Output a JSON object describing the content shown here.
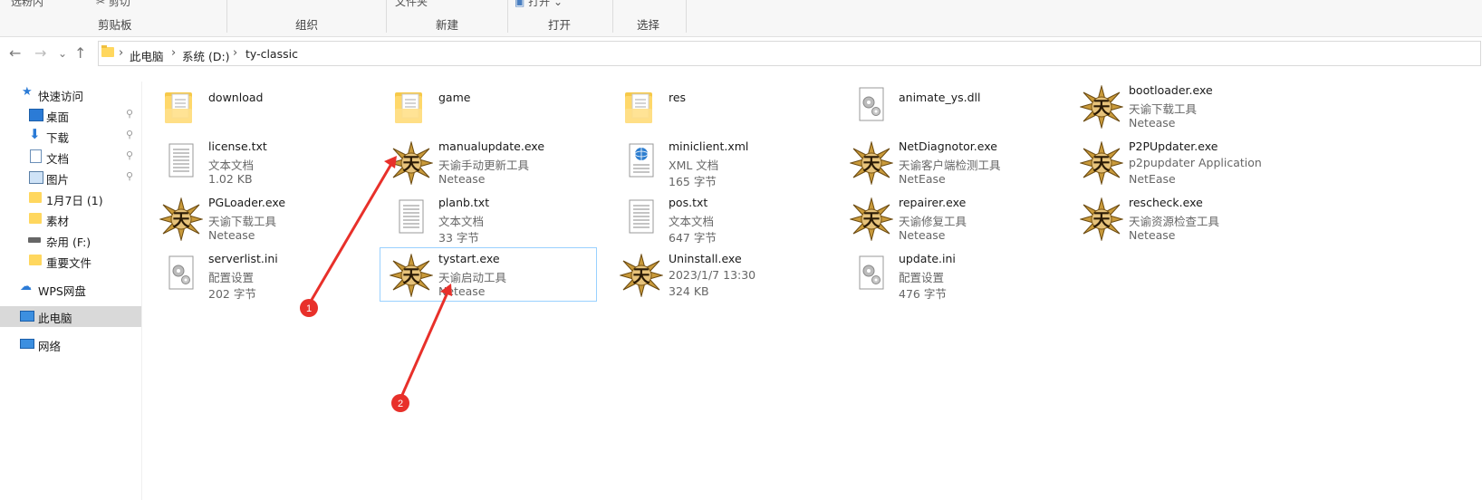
{
  "ribbon": {
    "fragments": [
      "选粉内",
      "剪切",
      "文件夹",
      "打开"
    ],
    "groups": [
      "剪贴板",
      "组织",
      "新建",
      "打开",
      "选择"
    ]
  },
  "nav": {
    "back": "←",
    "forward": "→",
    "dropdown": "⌄",
    "up": "↑",
    "breadcrumb": [
      "此电脑",
      "系统 (D:)",
      "ty-classic"
    ]
  },
  "sidebar": {
    "items": [
      {
        "label": "快速访问",
        "icon": "star-icon"
      },
      {
        "label": "桌面",
        "icon": "desktop-icon",
        "pinned": true
      },
      {
        "label": "下载",
        "icon": "download-icon",
        "pinned": true
      },
      {
        "label": "文档",
        "icon": "document-icon",
        "pinned": true
      },
      {
        "label": "图片",
        "icon": "picture-icon",
        "pinned": true
      },
      {
        "label": "1月7日 (1)",
        "icon": "folder-icon"
      },
      {
        "label": "素材",
        "icon": "folder-icon"
      },
      {
        "label": "杂用 (F:)",
        "icon": "drive-icon"
      },
      {
        "label": "重要文件",
        "icon": "folder-icon"
      },
      {
        "label": "WPS网盘",
        "icon": "cloud-icon"
      },
      {
        "label": "此电脑",
        "icon": "computer-icon",
        "selected": true
      },
      {
        "label": "网络",
        "icon": "network-icon"
      }
    ],
    "pin_glyph": "📌"
  },
  "files": [
    {
      "name": "download",
      "line2": "",
      "line3": "",
      "icon": "folder"
    },
    {
      "name": "game",
      "line2": "",
      "line3": "",
      "icon": "folder"
    },
    {
      "name": "res",
      "line2": "",
      "line3": "",
      "icon": "folder"
    },
    {
      "name": "animate_ys.dll",
      "line2": "",
      "line3": "",
      "icon": "dll"
    },
    {
      "name": "bootloader.exe",
      "line2": "天谕下载工具",
      "line3": "Netease",
      "icon": "tianyu"
    },
    {
      "name": "license.txt",
      "line2": "文本文档",
      "line3": "1.02 KB",
      "icon": "txt"
    },
    {
      "name": "manualupdate.exe",
      "line2": "天谕手动更新工具",
      "line3": "Netease",
      "icon": "tianyu"
    },
    {
      "name": "miniclient.xml",
      "line2": "XML 文档",
      "line3": "165 字节",
      "icon": "xml"
    },
    {
      "name": "NetDiagnotor.exe",
      "line2": "天谕客户端检测工具",
      "line3": "NetEase",
      "icon": "tianyu"
    },
    {
      "name": "P2PUpdater.exe",
      "line2": "p2pupdater Application",
      "line3": "NetEase",
      "icon": "tianyu"
    },
    {
      "name": "PGLoader.exe",
      "line2": "天谕下载工具",
      "line3": "Netease",
      "icon": "tianyu"
    },
    {
      "name": "planb.txt",
      "line2": "文本文档",
      "line3": "33 字节",
      "icon": "txt"
    },
    {
      "name": "pos.txt",
      "line2": "文本文档",
      "line3": "647 字节",
      "icon": "txt"
    },
    {
      "name": "repairer.exe",
      "line2": "天谕修复工具",
      "line3": "Netease",
      "icon": "tianyu"
    },
    {
      "name": "rescheck.exe",
      "line2": "天谕资源检查工具",
      "line3": "Netease",
      "icon": "tianyu"
    },
    {
      "name": "serverlist.ini",
      "line2": "配置设置",
      "line3": "202 字节",
      "icon": "ini"
    },
    {
      "name": "tystart.exe",
      "line2": "天谕启动工具",
      "line3": "Netease",
      "icon": "tianyu",
      "selected": true
    },
    {
      "name": "Uninstall.exe",
      "line2": "2023/1/7 13:30",
      "line3": "324 KB",
      "icon": "tianyu"
    },
    {
      "name": "update.ini",
      "line2": "配置设置",
      "line3": "476 字节",
      "icon": "ini"
    }
  ],
  "annotations": [
    {
      "label": "1"
    },
    {
      "label": "2"
    }
  ],
  "colors": {
    "annotation": "#e8302a",
    "selection": "#cce8ff",
    "folder": "#ffd75e"
  }
}
